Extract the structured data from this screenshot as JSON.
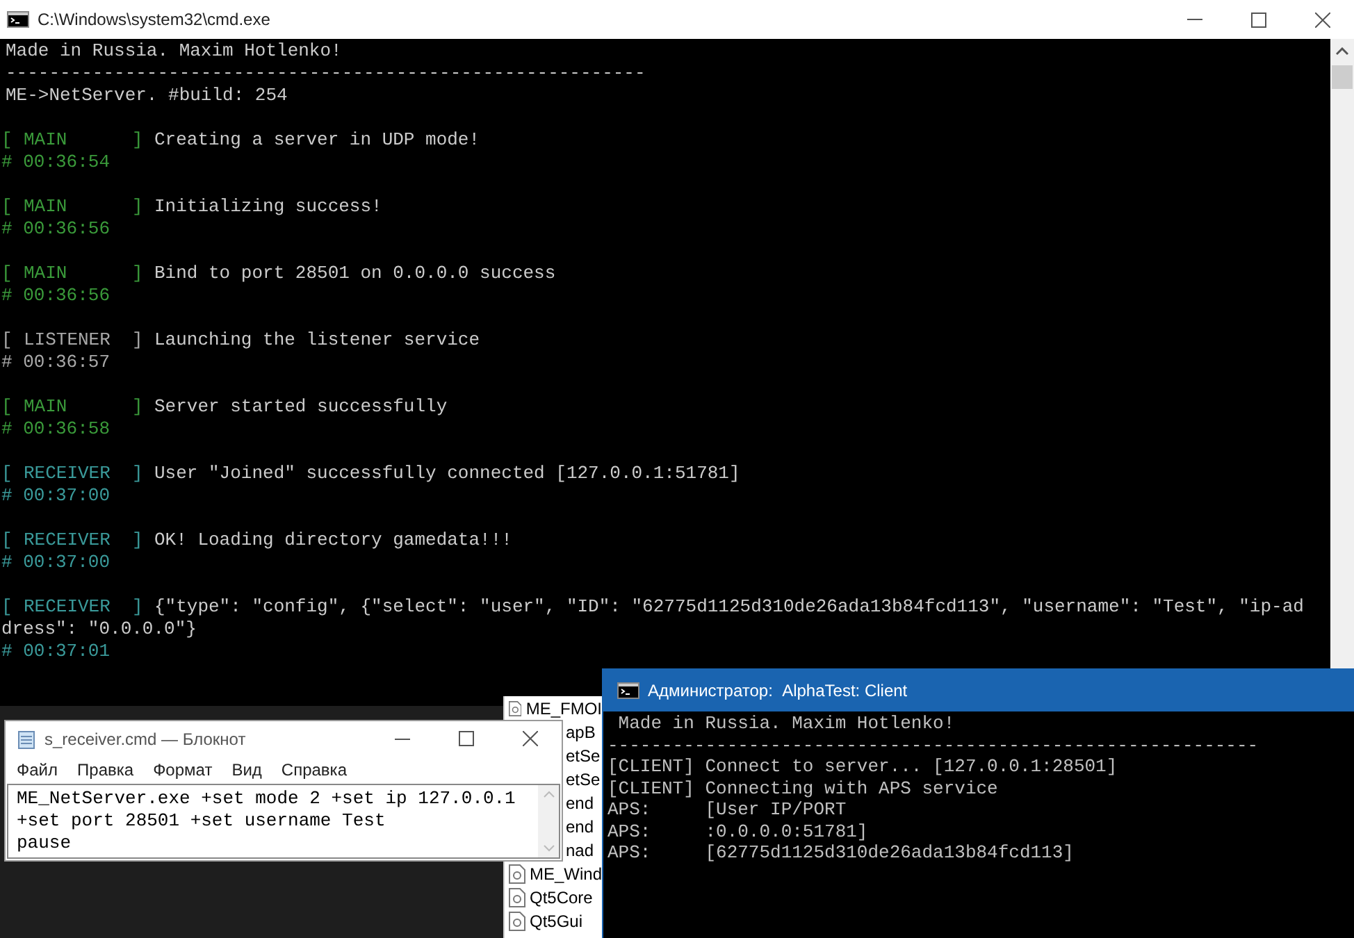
{
  "server_window": {
    "title": "C:\\Windows\\system32\\cmd.exe",
    "header_lines": [
      "Made in Russia. Maxim Hotlenko!",
      "-----------------------------------------------------------",
      "ME->NetServer. #build: 254"
    ],
    "log": [
      {
        "open": "[",
        "tag": "MAIN",
        "close": "]",
        "color": "#3a9a3a",
        "message": [
          "Creating a server in UDP mode!"
        ],
        "time": "# 00:36:54"
      },
      {
        "open": "[",
        "tag": "MAIN",
        "close": "]",
        "color": "#3a9a3a",
        "message": [
          "Initializing success!"
        ],
        "time": "# 00:36:56"
      },
      {
        "open": "[",
        "tag": "MAIN",
        "close": "]",
        "color": "#3a9a3a",
        "message": [
          "Bind to port 28501 on 0.0.0.0 success"
        ],
        "time": "# 00:36:56"
      },
      {
        "open": "[",
        "tag": "LISTENER",
        "close": "]",
        "color": "#a8a8a8",
        "message": [
          "Launching the listener service"
        ],
        "time": "# 00:36:57"
      },
      {
        "open": "[",
        "tag": "MAIN",
        "close": "]",
        "color": "#3a9a3a",
        "message": [
          "Server started successfully"
        ],
        "time": "# 00:36:58"
      },
      {
        "open": "[",
        "tag": "RECEIVER",
        "close": "]",
        "color": "#3a9a9a",
        "message": [
          "User \"Joined\" successfully connected [127.0.0.1:51781]"
        ],
        "time": "# 00:37:00"
      },
      {
        "open": "[",
        "tag": "RECEIVER",
        "close": "]",
        "color": "#3a9a9a",
        "message": [
          "OK! Loading directory gamedata!!!"
        ],
        "time": "# 00:37:00"
      },
      {
        "open": "[",
        "tag": "RECEIVER",
        "close": "]",
        "color": "#3a9a9a",
        "message": [
          "{\"type\": \"config\", {\"select\": \"user\", \"ID\": \"62775d1125d310de26ada13b84fcd113\", \"username\": \"Test\", \"ip-ad",
          "dress\": \"0.0.0.0\"}"
        ],
        "time": "# 00:37:01"
      }
    ]
  },
  "desktop_files": [
    {
      "kind": "full",
      "name": "ME_FMOI"
    },
    {
      "kind": "clipped",
      "name": "apB"
    },
    {
      "kind": "clipped",
      "name": "etSe"
    },
    {
      "kind": "clipped",
      "name": "etSe"
    },
    {
      "kind": "clipped",
      "name": "end"
    },
    {
      "kind": "clipped",
      "name": "end"
    },
    {
      "kind": "clipped",
      "name": "nad"
    },
    {
      "kind": "full",
      "name": "ME_Wind"
    },
    {
      "kind": "full",
      "name": "Qt5Core"
    },
    {
      "kind": "full",
      "name": "Qt5Gui"
    }
  ],
  "notepad": {
    "title": "s_receiver.cmd — Блокнот",
    "menu": [
      "Файл",
      "Правка",
      "Формат",
      "Вид",
      "Справка"
    ],
    "lines": [
      "ME_NetServer.exe +set mode 2 +set ip 127.0.0.1",
      "+set port 28501 +set username Test",
      "pause"
    ]
  },
  "client_window": {
    "title": "Администратор:  AlphaTest: Client",
    "lines": [
      " Made in Russia. Maxim Hotlenko!",
      "------------------------------------------------------------",
      "[CLIENT] Connect to server... [127.0.0.1:28501]",
      "[CLIENT] Connecting with APS service",
      "APS:     [User IP/PORT",
      "APS:     :0.0.0.0:51781]",
      "APS:     [62775d1125d310de26ada13b84fcd113]"
    ]
  }
}
